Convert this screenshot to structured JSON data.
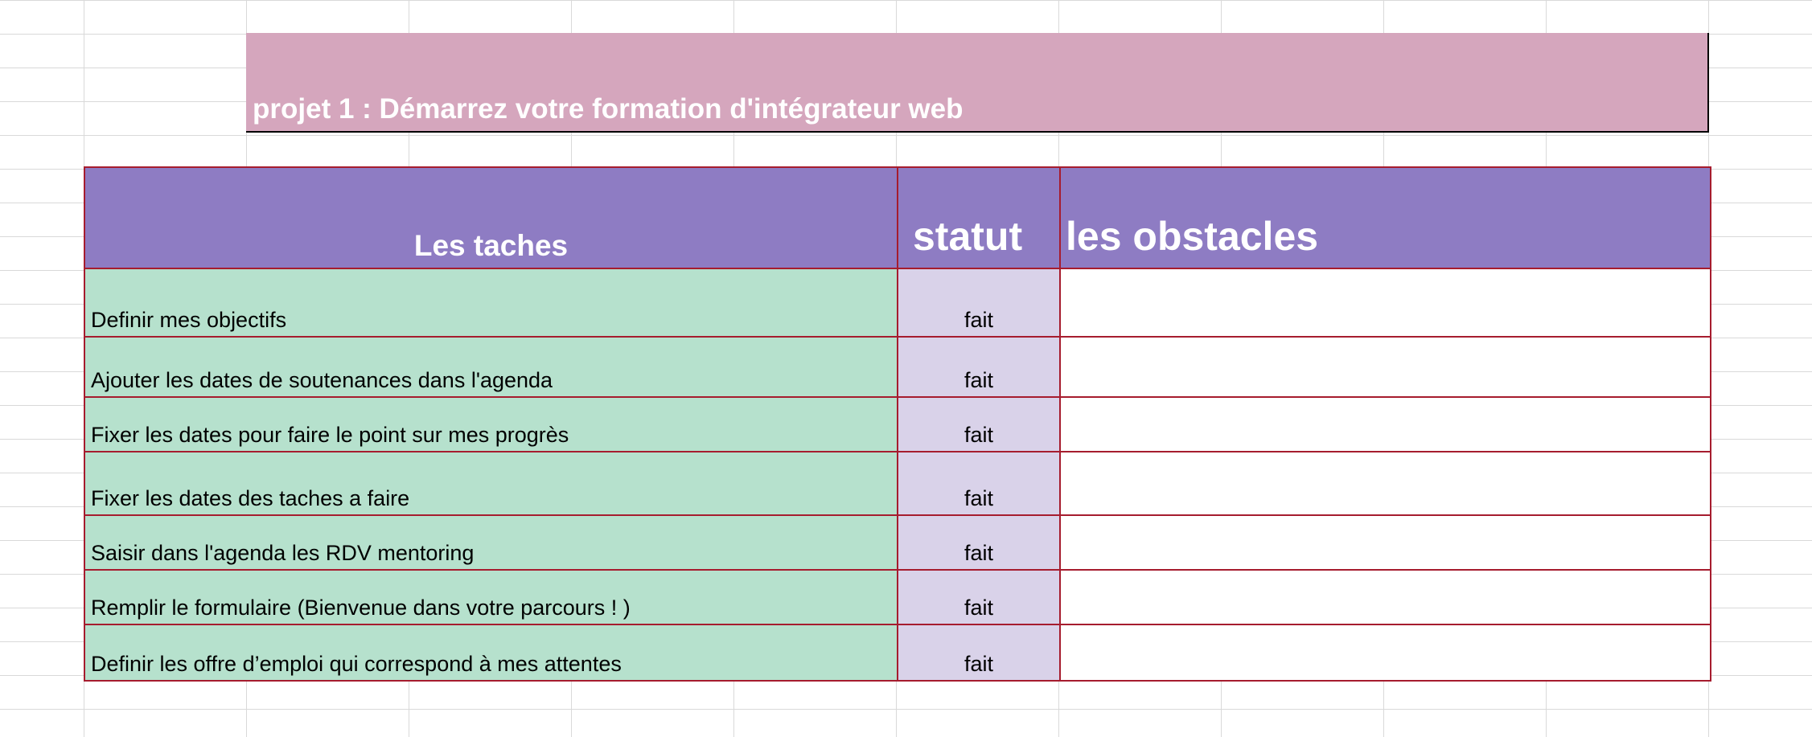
{
  "sheet": {
    "title": "projet 1 : Démarrez votre formation d'intégrateur web",
    "headers": {
      "tasks": "Les taches",
      "status": "statut",
      "obstacles": "les obstacles"
    },
    "rows": [
      {
        "task": "Definir mes objectifs",
        "status": "fait",
        "obstacle": ""
      },
      {
        "task": "Ajouter les dates de soutenances dans l'agenda",
        "status": "fait",
        "obstacle": ""
      },
      {
        "task": "Fixer les dates pour  faire le point sur mes progrès",
        "status": "fait",
        "obstacle": ""
      },
      {
        "task": "Fixer les  dates des taches a faire",
        "status": "fait",
        "obstacle": ""
      },
      {
        "task": "Saisir dans l'agenda les RDV mentoring",
        "status": "fait",
        "obstacle": ""
      },
      {
        "task": "Remplir le formulaire (Bienvenue dans votre parcours !  )",
        "status": "fait",
        "obstacle": ""
      },
      {
        "task": "Definir les offre d’emploi qui correspond à mes attentes",
        "status": "fait",
        "obstacle": ""
      }
    ]
  },
  "colors": {
    "title_bg": "#d5a6bd",
    "header_bg": "#8e7cc3",
    "task_bg": "#b6e1cd",
    "status_bg": "#d9d2e9",
    "border": "#a61c2e",
    "gridline": "#d9d9d9"
  }
}
